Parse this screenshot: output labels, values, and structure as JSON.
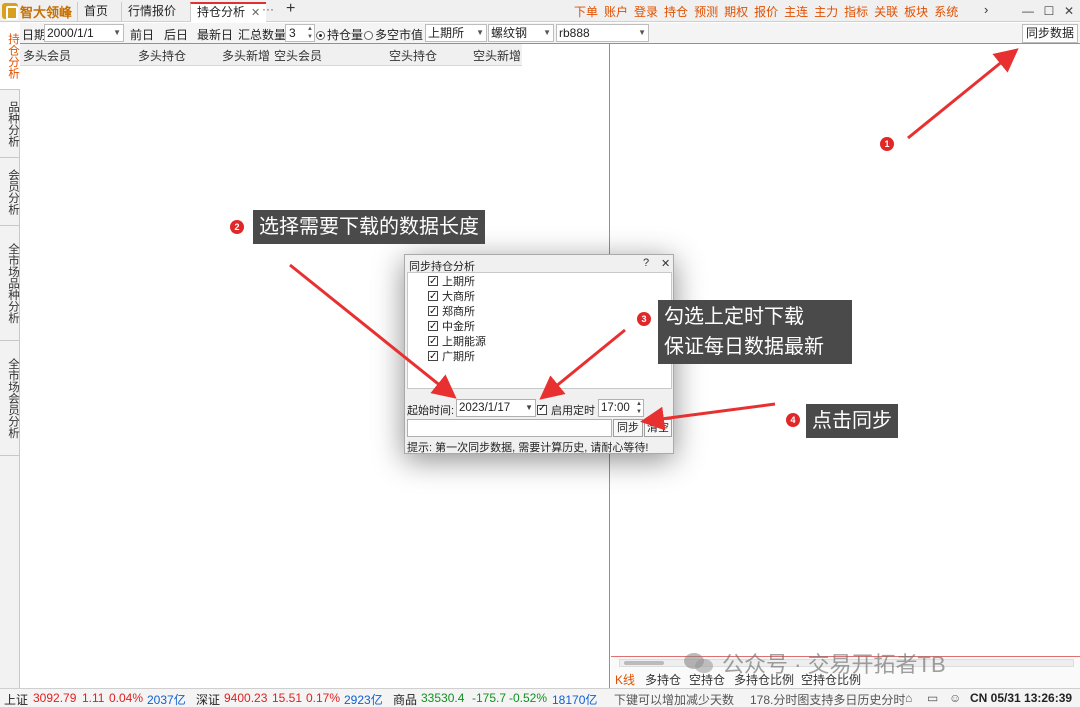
{
  "app": {
    "logo_text": "智大领峰",
    "tabs": [
      {
        "label": "首页"
      },
      {
        "label": "行情报价"
      },
      {
        "label": "持仓分析",
        "close": "✕"
      }
    ],
    "tab_more": "···",
    "tab_add": "+",
    "top_menu": [
      "下单",
      "账户",
      "登录",
      "持仓",
      "预测",
      "期权",
      "报价",
      "主连",
      "主力",
      "指标",
      "关联",
      "板块",
      "系统"
    ],
    "menu_arrow": "›",
    "window_buttons": {
      "minimize": "—",
      "maximize": "☐",
      "close": "✕"
    }
  },
  "left_tabs": [
    {
      "label": "持仓分析"
    },
    {
      "label": "品种分析"
    },
    {
      "label": "会员分析"
    },
    {
      "label": "全市场品种分析"
    },
    {
      "label": "全市场会员分析"
    }
  ],
  "toolbar": {
    "date_label": "日期",
    "date_value": "2000/1/1",
    "prev_day": "前日",
    "next_day": "后日",
    "latest_day": "最新日",
    "sum_label": "汇总数量",
    "sum_value": "3",
    "radio_position": "持仓量",
    "radio_value": "多空市值",
    "exchange_value": "上期所",
    "variety_value": "螺纹钢",
    "contract_value": "rb888",
    "sync_button": "同步数据"
  },
  "table": {
    "columns": [
      "多头会员",
      "多头持仓",
      "多头新增",
      "空头会员",
      "空头持仓",
      "空头新增"
    ]
  },
  "dialog": {
    "title": "同步持仓分析",
    "help": "?",
    "close": "✕",
    "exchanges": [
      {
        "name": "上期所",
        "checked": true
      },
      {
        "name": "大商所",
        "checked": true
      },
      {
        "name": "郑商所",
        "checked": true
      },
      {
        "name": "中金所",
        "checked": true
      },
      {
        "name": "上期能源",
        "checked": true
      },
      {
        "name": "广期所",
        "checked": true
      }
    ],
    "start_label": "起始时间:",
    "start_value": "2023/1/17",
    "timer_label": "启用定时",
    "timer_checked": true,
    "time_value": "17:00",
    "sync_button": "同步",
    "clear_button": "清空",
    "hint": "提示: 第一次同步数据, 需要计算历史, 请耐心等待!"
  },
  "right_bottom": {
    "tabs": [
      "K线",
      "多持仓",
      "空持仓",
      "多持仓比例",
      "空持仓比例"
    ]
  },
  "status": {
    "sh": {
      "name": "上证",
      "price": "3092.79",
      "change": "1.11",
      "pct": "0.04%",
      "amount": "2037亿"
    },
    "sz": {
      "name": "深证",
      "price": "9400.23",
      "change": "15.51",
      "pct": "0.17%",
      "amount": "2923亿"
    },
    "com": {
      "name": "商品",
      "price": "33530.4",
      "change": "-175.7",
      "pct": "-0.52%",
      "amount": "18170亿"
    },
    "tip1": "下键可以增加减少天数",
    "tip2": "178.分时图支持多日历史分时",
    "clock": "CN 05/31 13:26:39"
  },
  "annotations": [
    {
      "num": "1"
    },
    {
      "num": "2",
      "text": "选择需要下载的数据长度"
    },
    {
      "num": "3",
      "line1": "勾选上定时下载",
      "line2": "保证每日数据最新"
    },
    {
      "num": "4",
      "text": "点击同步"
    }
  ],
  "watermark": {
    "text": "公众号 · 交易开拓者TB"
  },
  "colors": {
    "accent": "#e05000",
    "up": "#e02020",
    "down": "#109020",
    "callout_bg": "#4a4a4a",
    "badge": "#e02828",
    "arrow": "#e83030"
  }
}
